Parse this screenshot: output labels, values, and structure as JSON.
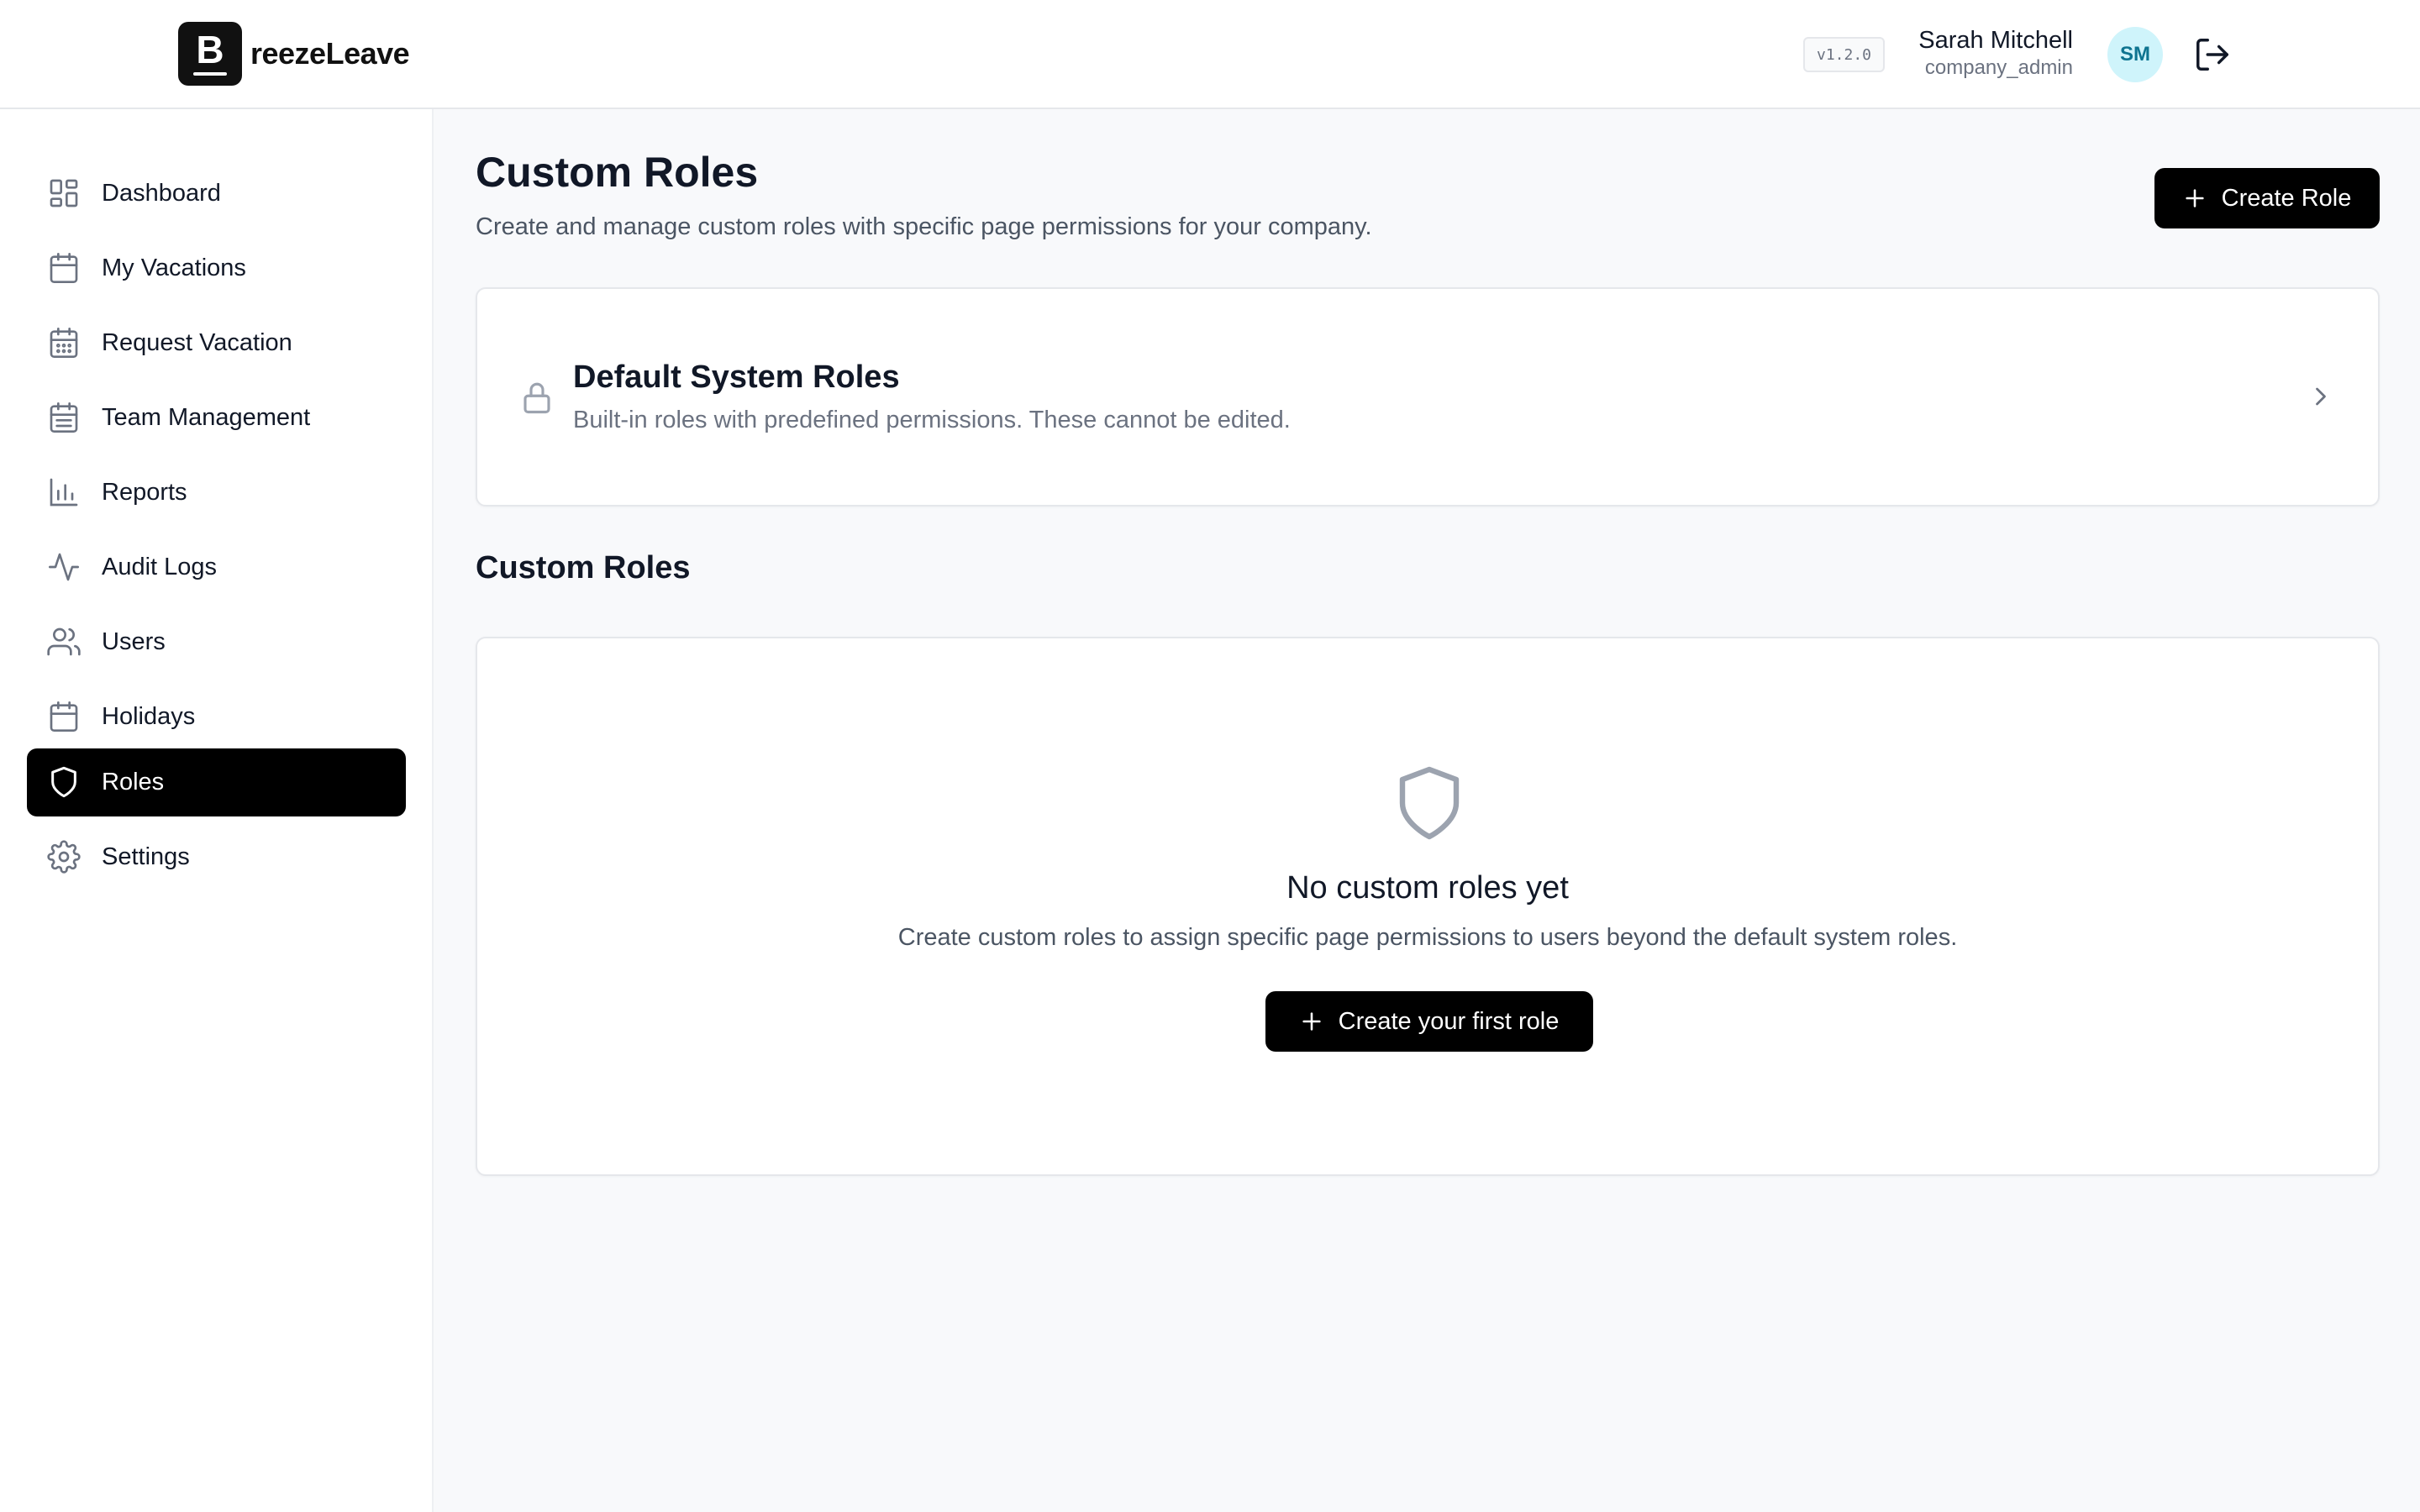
{
  "app": {
    "logo_letter": "B",
    "logo_text": "reezeLeave",
    "version": "v1.2.0"
  },
  "user": {
    "name": "Sarah Mitchell",
    "role": "company_admin",
    "initials": "SM"
  },
  "sidebar": {
    "items": [
      {
        "label": "Dashboard",
        "icon": "dashboard-icon",
        "active": false
      },
      {
        "label": "My Vacations",
        "icon": "calendar-icon",
        "active": false
      },
      {
        "label": "Request Vacation",
        "icon": "calendar-grid-icon",
        "active": false
      },
      {
        "label": "Team Management",
        "icon": "calendar-list-icon",
        "active": false
      },
      {
        "label": "Reports",
        "icon": "bar-chart-icon",
        "active": false
      },
      {
        "label": "Audit Logs",
        "icon": "activity-icon",
        "active": false
      },
      {
        "label": "Users",
        "icon": "users-icon",
        "active": false
      },
      {
        "label": "Holidays",
        "icon": "calendar-icon",
        "active": false
      },
      {
        "label": "Roles",
        "icon": "shield-icon",
        "active": true
      },
      {
        "label": "Settings",
        "icon": "gear-icon",
        "active": false
      }
    ]
  },
  "page": {
    "title": "Custom Roles",
    "subtitle": "Create and manage custom roles with specific page permissions for your company.",
    "create_button": "Create Role"
  },
  "system_roles": {
    "title": "Default System Roles",
    "description": "Built-in roles with predefined permissions. These cannot be edited."
  },
  "custom_roles": {
    "section_title": "Custom Roles",
    "empty_title": "No custom roles yet",
    "empty_description": "Create custom roles to assign specific page permissions to users beyond the default system roles.",
    "empty_button": "Create your first role"
  },
  "colors": {
    "accent": "#000000",
    "avatar_bg": "#cff4fb",
    "avatar_text": "#0e7490",
    "page_bg": "#f8f9fb"
  }
}
